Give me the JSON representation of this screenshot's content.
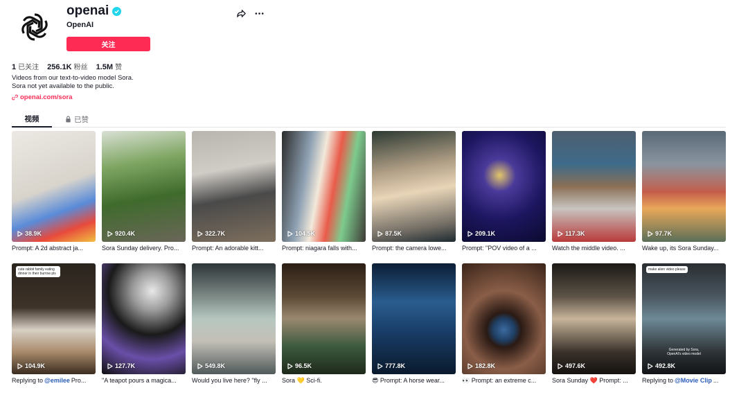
{
  "profile": {
    "username": "openai",
    "nickname": "OpenAI",
    "follow_label": "关注",
    "stats": [
      {
        "count": "1",
        "label": "已关注"
      },
      {
        "count": "256.1K",
        "label": "粉丝"
      },
      {
        "count": "1.5M",
        "label": "赞"
      }
    ],
    "bio_line1": "Videos from our text-to-video model Sora.",
    "bio_line2": "Sora not yet available to the public.",
    "link": "openai.com/sora"
  },
  "tabs": [
    {
      "label": "视频",
      "active": true
    },
    {
      "label": "已赞",
      "active": false,
      "icon": "lock-icon"
    }
  ],
  "videos": [
    {
      "views": "38.9K",
      "caption": "Prompt: A 2d abstract ja...",
      "bg": "linear-gradient(160deg,#ece9e4 0%,#d8d4cc 50%,#5a8bd8 70%,#e84a3c 85%,#f0c040 100%)"
    },
    {
      "views": "920.4K",
      "caption": "Sora Sunday delivery. Pro...",
      "bg": "linear-gradient(170deg,#d9e0d4 0%,#7fa663 30%,#3f6b2c 60%,#6a6658 100%)"
    },
    {
      "views": "322.7K",
      "caption": "Prompt: An adorable kitt...",
      "bg": "linear-gradient(170deg,#b8b4ae 0%,#d0ccc6 35%,#4a4a4a 60%,#7e6f5d 100%)"
    },
    {
      "views": "104.5K",
      "caption": "Prompt: niagara falls with...",
      "bg": "linear-gradient(100deg,#2b2b2b 0%,#8fa2b4 30%,#f2e9da 45%,#e95b4a 60%,#7dcb8e 75%,#3d3a34 100%)"
    },
    {
      "views": "87.5K",
      "caption": "Prompt: the camera lowe...",
      "bg": "linear-gradient(170deg,#2d3a33 0%,#b19f86 35%,#e8d5b8 55%,#6f6a62 85%,#1d2a30 100%)"
    },
    {
      "views": "209.1K",
      "caption": "Prompt: \"POV video of a ...",
      "bg": "radial-gradient(circle at 45% 40%,#e3c76a 0%,#4a3a9a 20%,#1d1660 55%,#0b0a2e 100%)"
    },
    {
      "views": "117.3K",
      "caption": "Watch the middle video. ...",
      "bg": "linear-gradient(180deg,#4e5f70 0%,#3e6b8a 30%,#8a6f55 50%,#c8c4c0 70%,#b83a3a 100%)"
    },
    {
      "views": "97.7K",
      "caption": "Wake up, its Sora Sunday...",
      "bg": "linear-gradient(180deg,#5b6a78 0%,#8a95a0 30%,#c45e4a 55%,#e8a85a 70%,#5a6e58 100%)"
    },
    {
      "views": "104.9K",
      "caption_pre": "Replying to ",
      "mention": "@emilee",
      "caption_post": " Pro...",
      "note": "cute rabbit family eating dinner in their burrow pls",
      "bg": "linear-gradient(180deg,#2a241e 0%,#3e3328 40%,#d8cfc4 60%,#a88a6a 80%,#3a2c20 100%)"
    },
    {
      "views": "127.7K",
      "caption": "\"A teapot pours a magica...",
      "bg": "radial-gradient(circle at 60% 25%,#e8e8e8 0%,#9b9b9b 20%,#1a1a1a 45%,#6a4fa8 70%,#0f0f0f 100%)"
    },
    {
      "views": "549.8K",
      "caption": "Would you live here? \"fly ...",
      "bg": "linear-gradient(180deg,#2e3538 0%,#7d8a86 30%,#b6c7c0 50%,#c4c0b8 70%,#505a5a 100%)"
    },
    {
      "views": "96.5K",
      "caption": "Sora 💛 Sci-fi.",
      "bg": "linear-gradient(180deg,#2b1e14 0%,#5c4a36 30%,#9a8870 50%,#3c5a3e 75%,#1e2a1a 100%)"
    },
    {
      "views": "777.8K",
      "caption": "😎 Prompt: A horse wear...",
      "bg": "linear-gradient(180deg,#0c1e36 0%,#2a5d8e 35%,#1a3f6a 60%,#0a1a2e 100%)"
    },
    {
      "views": "182.8K",
      "caption": "👀 Prompt: an extreme c...",
      "bg": "radial-gradient(circle at 50% 60%,#3b6aa0 0%,#1f3e62 14%,#2a1a14 22%,#8a5e48 50%,#3a2418 100%)"
    },
    {
      "views": "497.6K",
      "caption": "Sora Sunday ❤️ Prompt: ...",
      "bg": "linear-gradient(180deg,#1a1816 0%,#5e5448 30%,#c7b49a 50%,#3a322a 80%,#14120f 100%)"
    },
    {
      "views": "492.8K",
      "caption_pre": "Replying to ",
      "mention": "@Movie Clip",
      "caption_post": " ...",
      "note": "make alien video please",
      "bottom_note_1": "Generated by Sora,",
      "bottom_note_2": "OpenAI's video model",
      "bg": "linear-gradient(180deg,#2a2e32 0%,#4a5660 30%,#6e8a96 50%,#2e3438 80%,#121416 100%)"
    }
  ],
  "colors": {
    "accent": "#fe2c55",
    "verified": "#20d5ec",
    "mention": "#2b5db9"
  }
}
